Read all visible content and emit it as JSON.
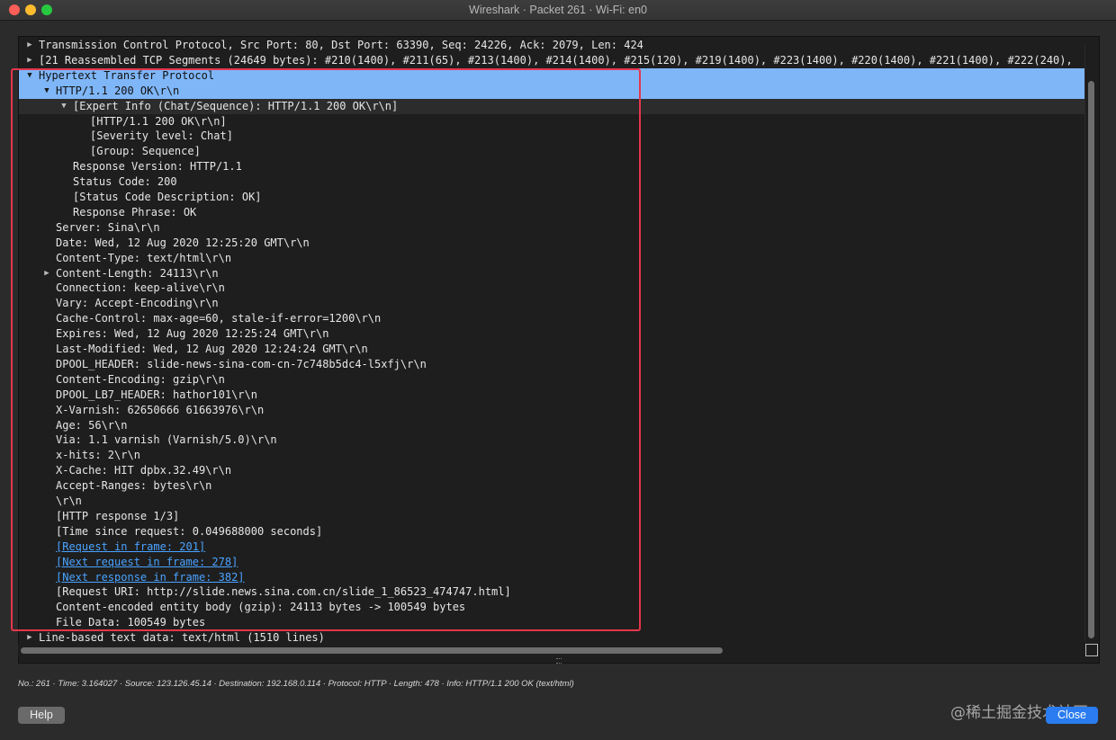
{
  "window": {
    "title": "Wireshark · Packet 261 · Wi-Fi: en0"
  },
  "icons": {
    "collapsed": "▶",
    "expanded": "▼"
  },
  "tree": {
    "rows": [
      {
        "text": "Transmission Control Protocol, Src Port: 80, Dst Port: 63390, Seq: 24226, Ack: 2079, Len: 424",
        "level": 0,
        "toggle": "collapsed"
      },
      {
        "text": "[21 Reassembled TCP Segments (24649 bytes): #210(1400), #211(65), #213(1400), #214(1400), #215(120), #219(1400), #223(1400), #220(1400), #221(1400), #222(240),",
        "level": 0,
        "toggle": "collapsed"
      },
      {
        "text": "Hypertext Transfer Protocol",
        "level": 0,
        "toggle": "expanded",
        "selected": true
      },
      {
        "text": "HTTP/1.1 200 OK\\r\\n",
        "level": 1,
        "toggle": "expanded",
        "selected": true
      },
      {
        "text": "[Expert Info (Chat/Sequence): HTTP/1.1 200 OK\\r\\n]",
        "level": 2,
        "toggle": "expanded",
        "subsel": true
      },
      {
        "text": "[HTTP/1.1 200 OK\\r\\n]",
        "level": 3
      },
      {
        "text": "[Severity level: Chat]",
        "level": 3
      },
      {
        "text": "[Group: Sequence]",
        "level": 3
      },
      {
        "text": "Response Version: HTTP/1.1",
        "level": 2
      },
      {
        "text": "Status Code: 200",
        "level": 2
      },
      {
        "text": "[Status Code Description: OK]",
        "level": 2
      },
      {
        "text": "Response Phrase: OK",
        "level": 2
      },
      {
        "text": "Server: Sina\\r\\n",
        "level": 1
      },
      {
        "text": "Date: Wed, 12 Aug 2020 12:25:20 GMT\\r\\n",
        "level": 1
      },
      {
        "text": "Content-Type: text/html\\r\\n",
        "level": 1
      },
      {
        "text": "Content-Length: 24113\\r\\n",
        "level": 1,
        "toggle": "collapsed"
      },
      {
        "text": "Connection: keep-alive\\r\\n",
        "level": 1
      },
      {
        "text": "Vary: Accept-Encoding\\r\\n",
        "level": 1
      },
      {
        "text": "Cache-Control: max-age=60, stale-if-error=1200\\r\\n",
        "level": 1
      },
      {
        "text": "Expires: Wed, 12 Aug 2020 12:25:24 GMT\\r\\n",
        "level": 1
      },
      {
        "text": "Last-Modified: Wed, 12 Aug 2020 12:24:24 GMT\\r\\n",
        "level": 1
      },
      {
        "text": "DPOOL_HEADER: slide-news-sina-com-cn-7c748b5dc4-l5xfj\\r\\n",
        "level": 1
      },
      {
        "text": "Content-Encoding: gzip\\r\\n",
        "level": 1
      },
      {
        "text": "DPOOL_LB7_HEADER: hathor101\\r\\n",
        "level": 1
      },
      {
        "text": "X-Varnish: 62650666 61663976\\r\\n",
        "level": 1
      },
      {
        "text": "Age: 56\\r\\n",
        "level": 1
      },
      {
        "text": "Via: 1.1 varnish (Varnish/5.0)\\r\\n",
        "level": 1
      },
      {
        "text": "x-hits: 2\\r\\n",
        "level": 1
      },
      {
        "text": "X-Cache: HIT dpbx.32.49\\r\\n",
        "level": 1
      },
      {
        "text": "Accept-Ranges: bytes\\r\\n",
        "level": 1
      },
      {
        "text": "\\r\\n",
        "level": 1
      },
      {
        "text": "[HTTP response 1/3]",
        "level": 1
      },
      {
        "text": "[Time since request: 0.049688000 seconds]",
        "level": 1
      },
      {
        "text": "[Request in frame: 201]",
        "level": 1,
        "link": true
      },
      {
        "text": "[Next request in frame: 278]",
        "level": 1,
        "link": true
      },
      {
        "text": "[Next response in frame: 382]",
        "level": 1,
        "link": true
      },
      {
        "text": "[Request URI: http://slide.news.sina.com.cn/slide_1_86523_474747.html]",
        "level": 1
      },
      {
        "text": "Content-encoded entity body (gzip): 24113 bytes -> 100549 bytes",
        "level": 1
      },
      {
        "text": "File Data: 100549 bytes",
        "level": 1
      },
      {
        "text": "Line-based text data: text/html (1510 lines)",
        "level": 0,
        "toggle": "collapsed"
      }
    ]
  },
  "status_bar": {
    "text": "No.: 261 · Time: 3.164027 · Source: 123.126.45.14 · Destination: 192.168.0.114 · Protocol: HTTP · Length: 478 · Info: HTTP/1.1 200 OK (text/html)"
  },
  "buttons": {
    "help": "Help",
    "close": "Close"
  },
  "watermark": "@稀土掘金技术社区",
  "colors": {
    "selection": "#7fb6f8",
    "link": "#4aa3ff",
    "highlight_box": "#e5364c",
    "close_button": "#2a7cf0"
  }
}
